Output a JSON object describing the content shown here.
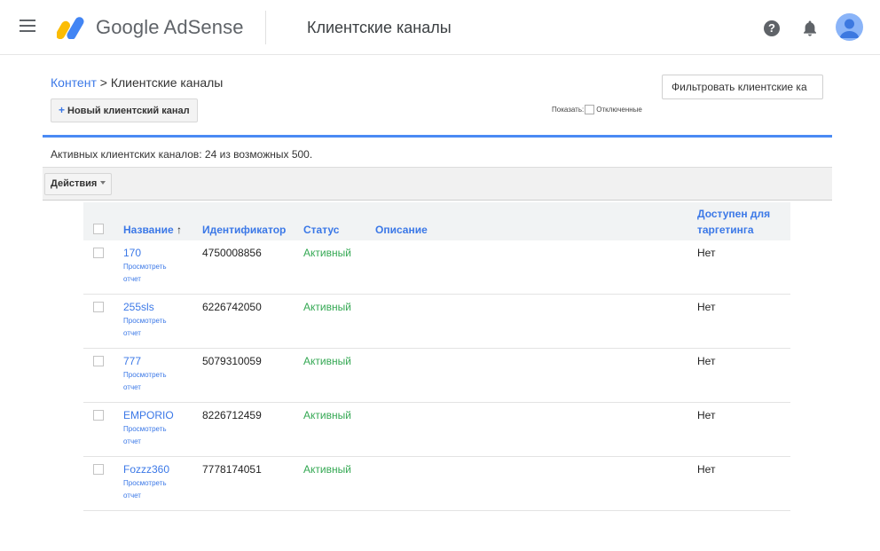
{
  "header": {
    "brand": "Google AdSense",
    "page_title": "Клиентские каналы",
    "help_glyph": "?"
  },
  "colors": {
    "accent_blue": "#3b78e7",
    "status_green": "#34a853",
    "logo_yellow": "#fbbc04",
    "logo_blue": "#4285f4",
    "rule_blue": "#4a8af4"
  },
  "breadcrumb": {
    "parent": "Контент",
    "separator": " > ",
    "current": "Клиентские каналы"
  },
  "toolbar": {
    "new_channel_plus": "+",
    "new_channel_label": "Новый клиентский канал",
    "filter_label": "Фильтровать клиентские ка",
    "show_label": "Показать:",
    "disabled_label": "Отключенные"
  },
  "summary": {
    "active_count": "Активных клиентских каналов: 24 из возможных 500."
  },
  "actions": {
    "label": "Действия"
  },
  "table": {
    "columns": {
      "name": "Название",
      "sort_arrow": "↑",
      "id": "Идентификатор",
      "status": "Статус",
      "description": "Описание",
      "available_line1": "Доступен для",
      "available_line2": "таргетинга"
    },
    "rows": [
      {
        "name": "170",
        "report": "Просмотреть отчет",
        "id": "4750008856",
        "status": "Активный",
        "description": "",
        "available": "Нет"
      },
      {
        "name": "255sls",
        "report": "Просмотреть отчет",
        "id": "6226742050",
        "status": "Активный",
        "description": "",
        "available": "Нет"
      },
      {
        "name": "777",
        "report": "Просмотреть отчет",
        "id": "5079310059",
        "status": "Активный",
        "description": "",
        "available": "Нет"
      },
      {
        "name": "EMPORIO",
        "report": "Просмотреть отчет",
        "id": "8226712459",
        "status": "Активный",
        "description": "",
        "available": "Нет"
      },
      {
        "name": "Fozzz360",
        "report": "Просмотреть отчет",
        "id": "7778174051",
        "status": "Активный",
        "description": "",
        "available": "Нет"
      }
    ]
  },
  "icons": {
    "menu": "menu-icon",
    "logo": "adsense-logo-icon",
    "help": "help-icon",
    "notifications": "bell-icon",
    "avatar": "account-avatar-icon"
  }
}
